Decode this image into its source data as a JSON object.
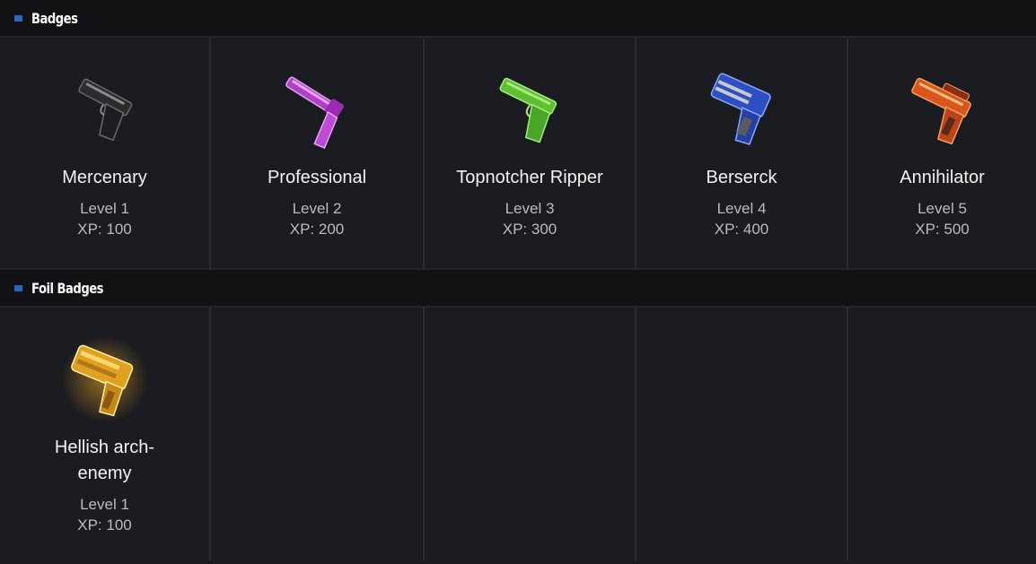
{
  "sections": {
    "badges": {
      "title": "Badges"
    },
    "foil": {
      "title": "Foil Badges"
    }
  },
  "badges": [
    {
      "name": "Mercenary",
      "level": "Level 1",
      "xp": "XP: 100",
      "icon": "black-pistol-icon",
      "color": "#3a3a3a"
    },
    {
      "name": "Professional",
      "level": "Level 2",
      "xp": "XP: 200",
      "icon": "purple-revolver-icon",
      "color": "#b040c8"
    },
    {
      "name": "Topnotcher Ripper",
      "level": "Level 3",
      "xp": "XP: 300",
      "icon": "green-pistol-icon",
      "color": "#5cc030"
    },
    {
      "name": "Berserck",
      "level": "Level 4",
      "xp": "XP: 400",
      "icon": "blue-pistol-icon",
      "color": "#2d4fc4"
    },
    {
      "name": "Annihilator",
      "level": "Level 5",
      "xp": "XP: 500",
      "icon": "orange-pistol-icon",
      "color": "#d8561e"
    }
  ],
  "foil_badges": [
    {
      "name": "Hellish arch-enemy",
      "level": "Level 1",
      "xp": "XP: 100",
      "icon": "gold-pistol-icon",
      "color": "#e0a020"
    }
  ]
}
